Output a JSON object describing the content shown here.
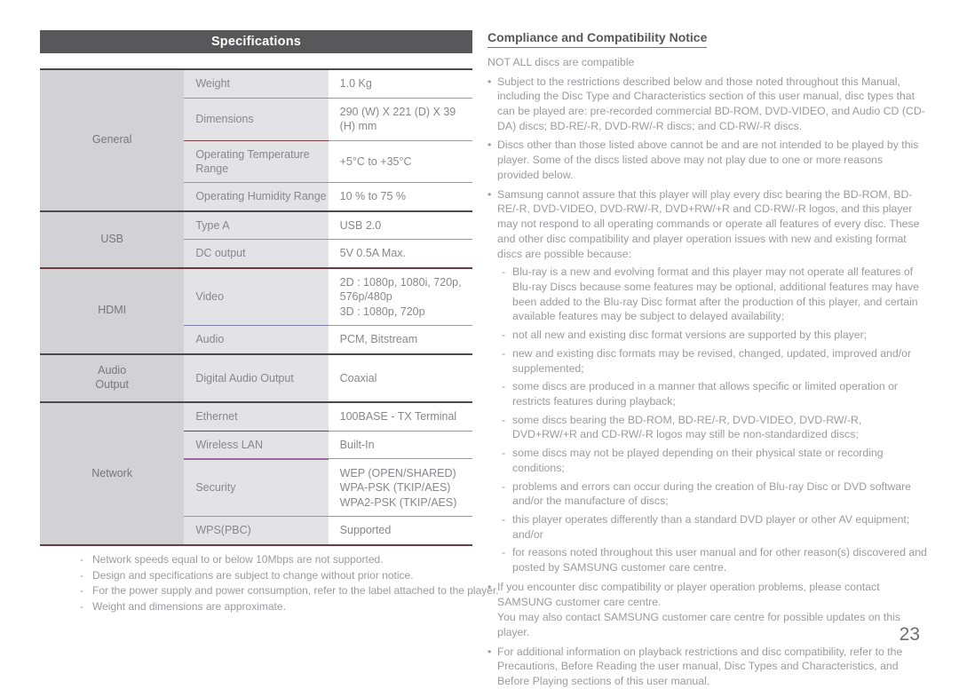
{
  "left": {
    "header_title": "Specifications",
    "table": {
      "groups": [
        {
          "name": "General",
          "rows": [
            {
              "item": "Weight",
              "value": "1.0 Kg"
            },
            {
              "item": "Dimensions",
              "value": "290 (W) X 221 (D) X 39 (H) mm"
            },
            {
              "item": "Operating Temperature Range",
              "value": "+5°C to +35°C"
            },
            {
              "item": "Operating Humidity Range",
              "value": "10 % to 75 %"
            }
          ]
        },
        {
          "name": "USB",
          "rows": [
            {
              "item": "Type A",
              "value": "USB 2.0"
            },
            {
              "item": "DC output",
              "value": "5V 0.5A Max."
            }
          ]
        },
        {
          "name": "HDMI",
          "rows": [
            {
              "item": "Video",
              "value": "2D : 1080p, 1080i, 720p, 576p/480p\n3D : 1080p, 720p"
            },
            {
              "item": "Audio",
              "value": "PCM, Bitstream"
            }
          ]
        },
        {
          "name": "Audio\nOutput",
          "rows": [
            {
              "item": "Digital Audio Output",
              "value": "Coaxial"
            }
          ]
        },
        {
          "name": "Network",
          "rows": [
            {
              "item": "Ethernet",
              "value": "100BASE - TX Terminal"
            },
            {
              "item": "Wireless LAN",
              "value": "Built-In"
            },
            {
              "item": "Security",
              "value": "WEP (OPEN/SHARED)\nWPA-PSK (TKIP/AES)\nWPA2-PSK (TKIP/AES)"
            },
            {
              "item": "WPS(PBC)",
              "value": "Supported"
            }
          ]
        }
      ]
    },
    "footnotes": [
      "Network speeds equal to or below 10Mbps are not supported.",
      "Design and specifications are subject to change without prior notice.",
      "For the power supply and power consumption, refer to the label attached to the player.",
      "Weight and dimensions are approximate."
    ],
    "footnote_marker": "-"
  },
  "right": {
    "title": "Compliance and Compatibility Notice",
    "intro": "NOT ALL discs are compatible",
    "bullet_marker": "•",
    "dash_marker": "-",
    "bullets": [
      {
        "text": "Subject to the restrictions described below and those noted throughout this Manual, including the Disc Type and Characteristics section of this user manual, disc types that can be played are: pre-recorded commercial BD-ROM, DVD-VIDEO, and Audio CD (CD-DA) discs; BD-RE/-R, DVD-RW/-R discs; and CD-RW/-R discs."
      },
      {
        "text": "Discs other than those listed above cannot be and are not intended to be played by this player. Some of the discs listed above may not play due to one or more reasons provided below."
      },
      {
        "text": "Samsung cannot assure that this player will play every disc bearing the BD-ROM, BD-RE/-R,  DVD-VIDEO, DVD-RW/-R, DVD+RW/+R and CD-RW/-R logos, and this player may not respond to all operating commands or operate all features of every disc. These and other disc compatibility and player operation issues with new and existing format discs are possible because:",
        "sub": [
          "Blu-ray is a new and evolving format and this player may not operate all features of Blu-ray Discs because some features may be optional, additional features may have been added to the Blu-ray Disc format after the production of this player, and certain available features may be subject to delayed availability;",
          "not all new and existing disc format versions are supported by this player;",
          "new and existing disc formats may be revised, changed, updated, improved and/or supplemented;",
          "some discs are produced in a manner that allows specific or limited operation or restricts features during playback;",
          "some discs bearing the BD-ROM, BD-RE/-R, DVD-VIDEO, DVD-RW/-R, DVD+RW/+R and CD-RW/-R logos may still be non-standardized discs;",
          "some discs may not be played depending on their physical state or recording conditions;",
          "problems and errors can occur during the creation of Blu-ray Disc or DVD software and/or the manufacture of discs;",
          "this player operates differently than a standard DVD player or other AV equipment; and/or",
          "for reasons noted throughout this user manual and for other reason(s) discovered and posted by SAMSUNG customer care centre."
        ]
      },
      {
        "text": "If you encounter disc compatibility or player operation problems, please contact SAMSUNG customer care centre.",
        "extra": "You may also contact SAMSUNG customer care centre for possible updates on this player."
      },
      {
        "text": "For additional information on playback restrictions and disc compatibility, refer to the Precautions, Before Reading the user manual, Disc Types and Characteristics, and Before Playing sections of this user manual."
      }
    ]
  },
  "page_number": "23",
  "colors": {
    "header_bar": "#58585a",
    "group_cell": "#d2d2d4",
    "item_cell": "#e3e3e5",
    "value_cell": "#ffffff",
    "body_text": "#9b9b9f",
    "rule_maroon": "#7a3f45",
    "rule_purple": "#9a6aa0",
    "rule_dark": "#4a4a4c"
  }
}
